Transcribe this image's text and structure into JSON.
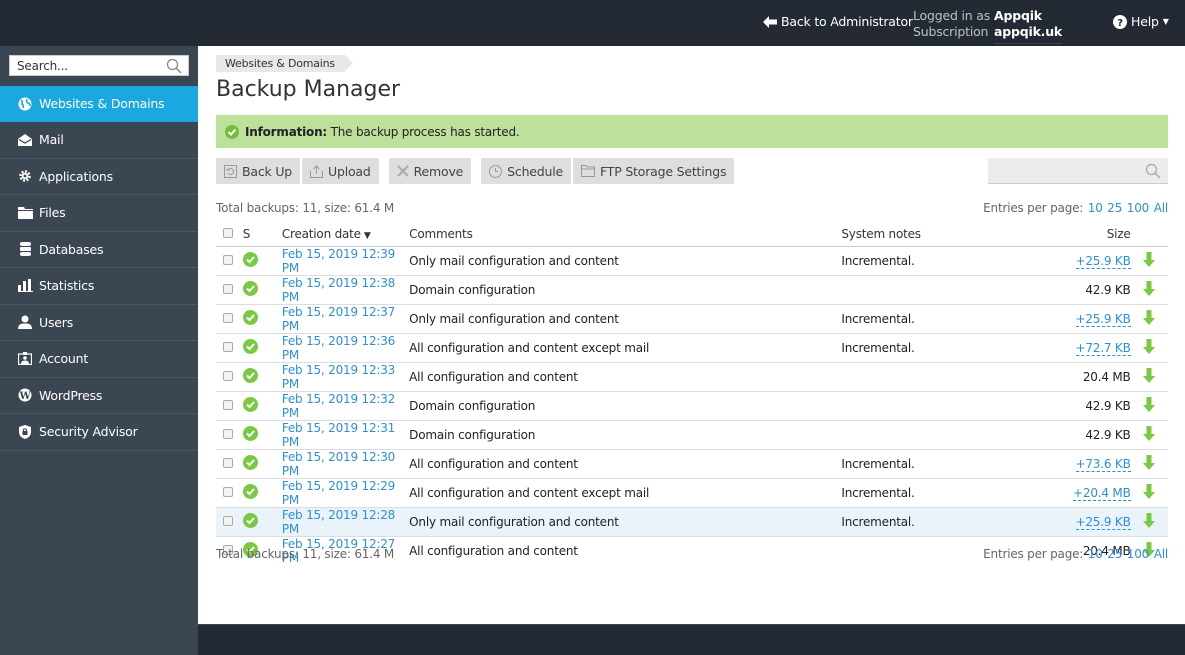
{
  "topbar": {
    "back_label": "Back to Administrator",
    "logged_in_label": "Logged in as",
    "subscription_label": "Subscription",
    "user": "Appqik",
    "subscription": "appqik.uk",
    "help_label": "Help"
  },
  "sidebar": {
    "search_placeholder": "Search...",
    "items": [
      {
        "label": "Websites & Domains",
        "icon": "globe-icon",
        "active": true
      },
      {
        "label": "Mail",
        "icon": "mail-icon"
      },
      {
        "label": "Applications",
        "icon": "gear-icon"
      },
      {
        "label": "Files",
        "icon": "folder-icon"
      },
      {
        "label": "Databases",
        "icon": "database-icon"
      },
      {
        "label": "Statistics",
        "icon": "bar-chart-icon"
      },
      {
        "label": "Users",
        "icon": "user-icon"
      },
      {
        "label": "Account",
        "icon": "id-card-icon"
      },
      {
        "label": "WordPress",
        "icon": "wordpress-icon"
      },
      {
        "label": "Security Advisor",
        "icon": "shield-lock-icon"
      }
    ]
  },
  "main": {
    "breadcrumb": "Websites & Domains",
    "title": "Backup Manager",
    "message": {
      "label": "Information:",
      "text": " The backup process has started."
    },
    "toolbar": {
      "backup": "Back Up",
      "upload": "Upload",
      "remove": "Remove",
      "schedule": "Schedule",
      "ftp": "FTP Storage Settings"
    },
    "summary": "Total backups: 11, size: 61.4 M",
    "entries_label": "Entries per page:",
    "entries_options": [
      "10",
      "25",
      "100",
      "All"
    ],
    "columns": {
      "s": "S",
      "date": "Creation date",
      "comments": "Comments",
      "notes": "System notes",
      "size": "Size"
    },
    "rows": [
      {
        "date": "Feb 15, 2019 12:39 PM",
        "comment": "Only mail configuration and content",
        "notes": "Incremental.",
        "size": "+25.9 KB",
        "incremental": true
      },
      {
        "date": "Feb 15, 2019 12:38 PM",
        "comment": "Domain configuration",
        "notes": "",
        "size": "42.9 KB",
        "incremental": false
      },
      {
        "date": "Feb 15, 2019 12:37 PM",
        "comment": "Only mail configuration and content",
        "notes": "Incremental.",
        "size": "+25.9 KB",
        "incremental": true
      },
      {
        "date": "Feb 15, 2019 12:36 PM",
        "comment": "All configuration and content except mail",
        "notes": "Incremental.",
        "size": "+72.7 KB",
        "incremental": true
      },
      {
        "date": "Feb 15, 2019 12:33 PM",
        "comment": "All configuration and content",
        "notes": "",
        "size": "20.4 MB",
        "incremental": false
      },
      {
        "date": "Feb 15, 2019 12:32 PM",
        "comment": "Domain configuration",
        "notes": "",
        "size": "42.9 KB",
        "incremental": false
      },
      {
        "date": "Feb 15, 2019 12:31 PM",
        "comment": "Domain configuration",
        "notes": "",
        "size": "42.9 KB",
        "incremental": false
      },
      {
        "date": "Feb 15, 2019 12:30 PM",
        "comment": "All configuration and content",
        "notes": "Incremental.",
        "size": "+73.6 KB",
        "incremental": true
      },
      {
        "date": "Feb 15, 2019 12:29 PM",
        "comment": "All configuration and content except mail",
        "notes": "Incremental.",
        "size": "+20.4 MB",
        "incremental": true
      },
      {
        "date": "Feb 15, 2019 12:28 PM",
        "comment": "Only mail configuration and content",
        "notes": "Incremental.",
        "size": "+25.9 KB",
        "incremental": true,
        "highlighted": true
      },
      {
        "date": "Feb 15, 2019 12:27 PM",
        "comment": "All configuration and content",
        "notes": "",
        "size": "20.4 MB",
        "incremental": false
      }
    ]
  },
  "colors": {
    "topbar": "#232a33",
    "sidebar": "#3b4653",
    "active": "#1ba8e0",
    "link": "#2f8fd6",
    "success": "#7ac943",
    "info_bg": "#bde09a"
  }
}
